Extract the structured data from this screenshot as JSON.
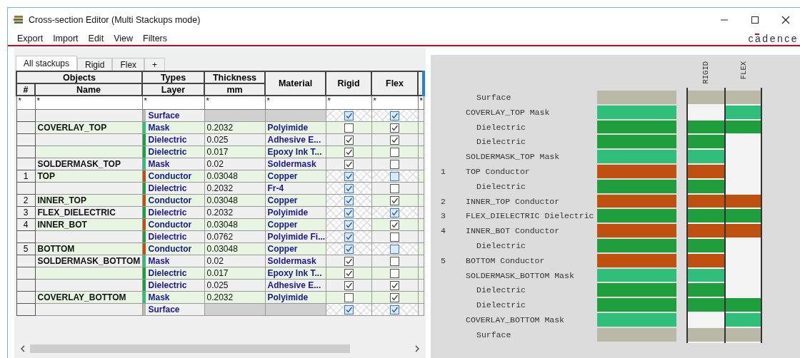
{
  "window": {
    "title": "Cross-section Editor (Multi Stackups mode)"
  },
  "menu": [
    "Export",
    "Import",
    "Edit",
    "View",
    "Filters"
  ],
  "logo": "cadence",
  "tabs": [
    {
      "label": "All stackups",
      "selected": true
    },
    {
      "label": "Rigid",
      "selected": false
    },
    {
      "label": "Flex",
      "selected": false
    },
    {
      "label": "+",
      "selected": false
    }
  ],
  "table": {
    "headers": {
      "objects": "Objects",
      "number": "#",
      "name": "Name",
      "types": "Types",
      "layer": "Layer",
      "thickness": "Thickness",
      "unit": "mm",
      "material": "Material",
      "rigid": "Rigid",
      "flex": "Flex"
    },
    "filters": [
      "*",
      "*",
      "*",
      "*",
      "*",
      "*",
      "*",
      "*"
    ],
    "rows": [
      {
        "kind": "surface",
        "layer": "Surface",
        "color": "#b9b9a8",
        "rigid": {
          "checked": true,
          "locked": true
        },
        "flex": {
          "checked": true,
          "locked": true
        }
      },
      {
        "kind": "layer",
        "name": "COVERLAY_TOP",
        "layer": "Mask",
        "color": "#2fbf7a",
        "thickness": "0.2032",
        "material": "Polyimide",
        "rigid": {
          "checked": false,
          "locked": false
        },
        "flex": {
          "checked": true,
          "locked": false
        }
      },
      {
        "kind": "layer",
        "layer": "Dielectric",
        "color": "#1e9e3c",
        "thickness": "0.025",
        "material": "Adhesive E...",
        "rigid": {
          "checked": true,
          "locked": false
        },
        "flex": {
          "checked": true,
          "locked": false
        }
      },
      {
        "kind": "layer",
        "layer": "Dielectric",
        "color": "#1e9e3c",
        "thickness": "0.017",
        "material": "Epoxy Ink T...",
        "rigid": {
          "checked": true,
          "locked": false
        },
        "flex": {
          "checked": false,
          "locked": false
        }
      },
      {
        "kind": "layer",
        "name": "SOLDERMASK_TOP",
        "layer": "Mask",
        "color": "#2fbf7a",
        "thickness": "0.02",
        "material": "Soldermask",
        "rigid": {
          "checked": true,
          "locked": false
        },
        "flex": {
          "checked": false,
          "locked": false
        }
      },
      {
        "kind": "layer",
        "number": "1",
        "name": "TOP",
        "layer": "Conductor",
        "color": "#c0500f",
        "thickness": "0.03048",
        "material": "Copper",
        "rigid": {
          "checked": true,
          "locked": true
        },
        "flex": {
          "checked": false,
          "locked": true
        }
      },
      {
        "kind": "layer",
        "layer": "Dielectric",
        "color": "#1e9e3c",
        "thickness": "0.2032",
        "material": "Fr-4",
        "rigid": {
          "checked": true,
          "locked": true
        },
        "flex": {
          "checked": false,
          "locked": false
        }
      },
      {
        "kind": "layer",
        "number": "2",
        "name": "INNER_TOP",
        "layer": "Conductor",
        "color": "#c0500f",
        "thickness": "0.03048",
        "material": "Copper",
        "rigid": {
          "checked": true,
          "locked": true
        },
        "flex": {
          "checked": true,
          "locked": false
        }
      },
      {
        "kind": "layer",
        "number": "3",
        "name": "FLEX_DIELECTRIC",
        "layer": "Dielectric",
        "color": "#1e9e3c",
        "thickness": "0.2032",
        "material": "Polyimide",
        "rigid": {
          "checked": true,
          "locked": true
        },
        "flex": {
          "checked": true,
          "locked": true
        }
      },
      {
        "kind": "layer",
        "number": "4",
        "name": "INNER_BOT",
        "layer": "Conductor",
        "color": "#c0500f",
        "thickness": "0.03048",
        "material": "Copper",
        "rigid": {
          "checked": true,
          "locked": true
        },
        "flex": {
          "checked": true,
          "locked": false
        }
      },
      {
        "kind": "layer",
        "layer": "Dielectric",
        "color": "#1e9e3c",
        "thickness": "0.0762",
        "material": "Polyimide Fi...",
        "rigid": {
          "checked": true,
          "locked": true
        },
        "flex": {
          "checked": false,
          "locked": false
        }
      },
      {
        "kind": "layer",
        "number": "5",
        "name": "BOTTOM",
        "layer": "Conductor",
        "color": "#c0500f",
        "thickness": "0.03048",
        "material": "Copper",
        "rigid": {
          "checked": true,
          "locked": true
        },
        "flex": {
          "checked": false,
          "locked": true
        }
      },
      {
        "kind": "layer",
        "name": "SOLDERMASK_BOTTOM",
        "layer": "Mask",
        "color": "#2fbf7a",
        "thickness": "0.02",
        "material": "Soldermask",
        "rigid": {
          "checked": true,
          "locked": false
        },
        "flex": {
          "checked": false,
          "locked": false
        }
      },
      {
        "kind": "layer",
        "layer": "Dielectric",
        "color": "#1e9e3c",
        "thickness": "0.017",
        "material": "Epoxy Ink T...",
        "rigid": {
          "checked": true,
          "locked": false
        },
        "flex": {
          "checked": false,
          "locked": false
        }
      },
      {
        "kind": "layer",
        "layer": "Dielectric",
        "color": "#1e9e3c",
        "thickness": "0.025",
        "material": "Adhesive E...",
        "rigid": {
          "checked": true,
          "locked": false
        },
        "flex": {
          "checked": true,
          "locked": false
        }
      },
      {
        "kind": "layer",
        "name": "COVERLAY_BOTTOM",
        "layer": "Mask",
        "color": "#2fbf7a",
        "thickness": "0.2032",
        "material": "Polyimide",
        "rigid": {
          "checked": false,
          "locked": false
        },
        "flex": {
          "checked": true,
          "locked": false
        }
      },
      {
        "kind": "surface",
        "layer": "Surface",
        "color": "#b9b9a8",
        "rigid": {
          "checked": true,
          "locked": true
        },
        "flex": {
          "checked": true,
          "locked": true
        }
      }
    ]
  },
  "stack": {
    "columns": [
      "RIGID",
      "FLEX"
    ],
    "rows": [
      {
        "label": "Surface",
        "indented": true,
        "color": "#b9b9a8",
        "rigid": true,
        "flex": true
      },
      {
        "label": "COVERLAY_TOP Mask",
        "indented": false,
        "color": "#2fbf7a",
        "rigid": false,
        "flex": true
      },
      {
        "label": "Dielectric",
        "indented": true,
        "color": "#1e9e3c",
        "rigid": true,
        "flex": true
      },
      {
        "label": "Dielectric",
        "indented": true,
        "color": "#1e9e3c",
        "rigid": true,
        "flex": false
      },
      {
        "label": "SOLDERMASK_TOP Mask",
        "indented": false,
        "color": "#2fbf7a",
        "rigid": true,
        "flex": false
      },
      {
        "number": "1",
        "label": "TOP Conductor",
        "indented": false,
        "color": "#c0500f",
        "rigid": true,
        "flex": false
      },
      {
        "label": "Dielectric",
        "indented": true,
        "color": "#1e9e3c",
        "rigid": true,
        "flex": false
      },
      {
        "number": "2",
        "label": "INNER_TOP Conductor",
        "indented": false,
        "color": "#c0500f",
        "rigid": true,
        "flex": true
      },
      {
        "number": "3",
        "label": "FLEX_DIELECTRIC Dielectric",
        "indented": false,
        "color": "#1e9e3c",
        "rigid": true,
        "flex": true
      },
      {
        "number": "4",
        "label": "INNER_BOT Conductor",
        "indented": false,
        "color": "#c0500f",
        "rigid": true,
        "flex": true
      },
      {
        "label": "Dielectric",
        "indented": true,
        "color": "#1e9e3c",
        "rigid": true,
        "flex": false
      },
      {
        "number": "5",
        "label": "BOTTOM Conductor",
        "indented": false,
        "color": "#c0500f",
        "rigid": true,
        "flex": false
      },
      {
        "label": "SOLDERMASK_BOTTOM Mask",
        "indented": false,
        "color": "#2fbf7a",
        "rigid": true,
        "flex": false
      },
      {
        "label": "Dielectric",
        "indented": true,
        "color": "#1e9e3c",
        "rigid": true,
        "flex": false
      },
      {
        "label": "Dielectric",
        "indented": true,
        "color": "#1e9e3c",
        "rigid": true,
        "flex": true
      },
      {
        "label": "COVERLAY_BOTTOM Mask",
        "indented": false,
        "color": "#2fbf7a",
        "rigid": false,
        "flex": true
      },
      {
        "label": "Surface",
        "indented": true,
        "color": "#b9b9a8",
        "rigid": true,
        "flex": true
      }
    ]
  }
}
